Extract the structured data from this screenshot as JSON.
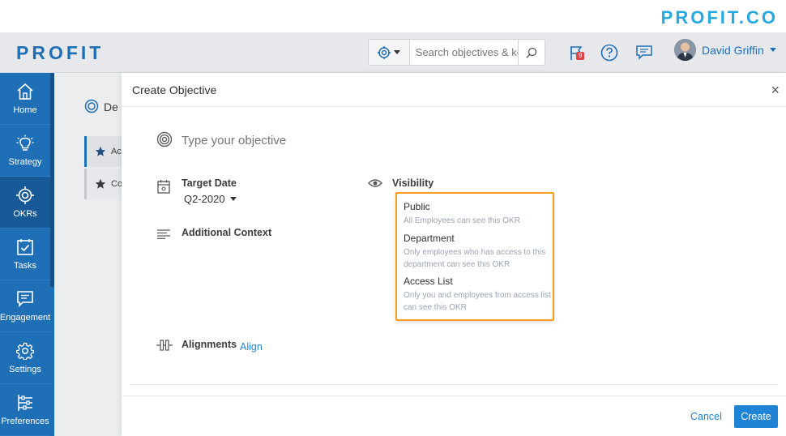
{
  "brand": {
    "logo_text": "PROFIT.CO",
    "color": "#29a8e0"
  },
  "header": {
    "app_logo": "PROFIT",
    "search": {
      "placeholder": "Search objectives & ke"
    },
    "flag_badge_count": "9",
    "user_name": "David Griffin"
  },
  "sidebar": {
    "items": [
      {
        "label": "Home",
        "icon": "home-icon"
      },
      {
        "label": "Strategy",
        "icon": "lightbulb-icon"
      },
      {
        "label": "OKRs",
        "icon": "target-icon",
        "active": true
      },
      {
        "label": "Tasks",
        "icon": "checkbox-icon"
      },
      {
        "label": "Engagement",
        "icon": "chat-icon"
      },
      {
        "label": "Settings",
        "icon": "gear-icon"
      },
      {
        "label": "Preferences",
        "icon": "sliders-icon"
      }
    ]
  },
  "background": {
    "title": "De",
    "tabs": [
      {
        "label": "Ac"
      },
      {
        "label": "Co"
      }
    ]
  },
  "modal": {
    "title": "Create Objective",
    "close": "×",
    "objective_placeholder": "Type your objective",
    "target_date_label": "Target Date",
    "target_date_value": "Q2-2020",
    "visibility_label": "Visibility",
    "additional_context_label": "Additional Context",
    "alignments_label": "Alignments",
    "align_link": "Align",
    "cancel_label": "Cancel",
    "create_label": "Create"
  },
  "visibility_options": [
    {
      "title": "Public",
      "description": "All Employees can see this OKR"
    },
    {
      "title": "Department",
      "description": "Only employees who has access to this department can see this OKR"
    },
    {
      "title": "Access List",
      "description": "Only you and employees from access list can see this OKR"
    }
  ],
  "colors": {
    "primary": "#1f6fb6",
    "accent_link": "#1f84d6",
    "highlight_border": "#f59d1e",
    "badge": "#e04343"
  }
}
